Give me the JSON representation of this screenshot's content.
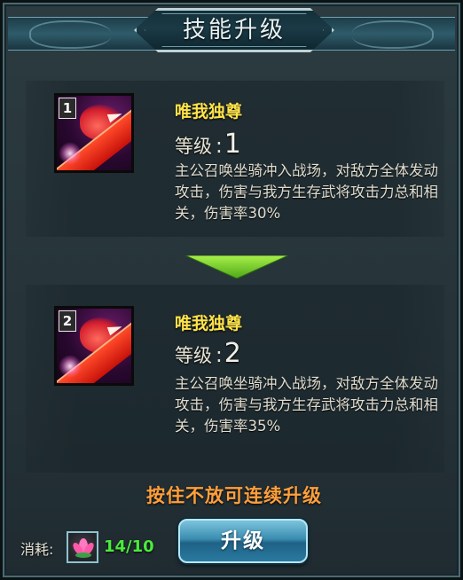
{
  "dialog": {
    "title": "技能升级"
  },
  "current_skill": {
    "level_badge": "1",
    "name": "唯我独尊",
    "level_label": "等级",
    "level_colon": ":",
    "level_value": "1",
    "description": "主公召唤坐骑冲入战场，对敌方全体发动攻击，伤害与我方生存武将攻击力总和相关，伤害率30%",
    "icon": "red-beast-skill-icon"
  },
  "next_skill": {
    "level_badge": "2",
    "name": "唯我独尊",
    "level_label": "等级",
    "level_colon": ":",
    "level_value": "2",
    "description": "主公召唤坐骑冲入战场，对敌方全体发动攻击，伤害与我方生存武将攻击力总和相关，伤害率35%",
    "icon": "red-beast-skill-icon"
  },
  "hint": "按住不放可连续升级",
  "cost": {
    "label": "消耗:",
    "item_icon": "lotus-flower-icon",
    "count": "14/10"
  },
  "upgrade_button": {
    "label": "升级"
  },
  "colors": {
    "skill_name": "#ffe34a",
    "hint": "#ff9f3c",
    "count": "#4bea3b",
    "arrow": "#7cd72a"
  }
}
